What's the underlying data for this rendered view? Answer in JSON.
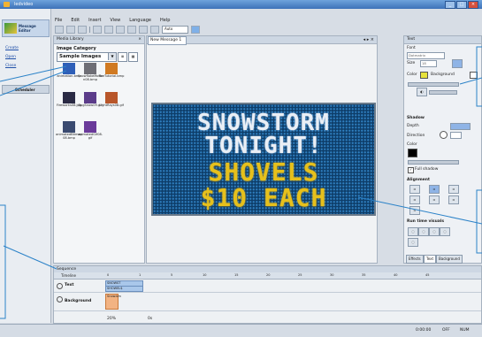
{
  "window": {
    "title": "ledvideo"
  },
  "menu": [
    "File",
    "Edit",
    "Insert",
    "View",
    "Language",
    "Help"
  ],
  "toolbar": {
    "zoom": "Auto"
  },
  "leftnav": {
    "message_editor_label": "Message Editor",
    "links": [
      "Create",
      "Open",
      "Close"
    ],
    "scheduler_label": "Scheduler"
  },
  "media_library": {
    "title": "Media Library",
    "category_label": "Image Category",
    "category_value": "Sample Images",
    "thumbnails": [
      {
        "name": "animation.bmp",
        "color": "#2e5fb8"
      },
      {
        "name": "SnowflakeMotion08.bmp",
        "color": "#6e6e76"
      },
      {
        "name": "FireTutorial.bmp",
        "color": "#d07a22"
      },
      {
        "name": "Fireworks08.jpg",
        "color": "#2a2a44"
      },
      {
        "name": "BugSnow09.gif",
        "color": "#5b3c8a"
      },
      {
        "name": "LightRays08.gif",
        "color": "#b8562a"
      },
      {
        "name": "animatedBitmap08.bmp",
        "color": "#3a4a70"
      },
      {
        "name": "animatedGif08.gif",
        "color": "#6a3a9a"
      }
    ]
  },
  "editor": {
    "tab_label": "New Message 1",
    "sign_lines": [
      "SNOWSTORM",
      "TONIGHT!",
      "SHOVELS",
      "$10 EACH"
    ],
    "text_color": "#e9eef5",
    "accent_color": "#e6c01c"
  },
  "text_panel": {
    "title": "Text",
    "font_label": "Font",
    "font_value": "Dotmatrix",
    "size_label": "Size",
    "size_value": "18",
    "color_label": "Color",
    "background_label": "Background",
    "shadow_label": "Shadow",
    "depth_label": "Depth",
    "direction_label": "Direction",
    "shadow_color_label": "Color",
    "full_shadow_label": "Full shadow",
    "alignment_label": "Alignment",
    "run_time_label": "Run time visuals",
    "tabs": [
      "Effects",
      "Text",
      "Background"
    ]
  },
  "timeline": {
    "title": "Sequence",
    "timeline_label": "Timeline",
    "row_text": "Text",
    "row_bg": "Background",
    "bar1": "SNOWST",
    "bar2": "SHOWEL$",
    "bar3": "Snow.bm",
    "zoom": "20%",
    "value": "0s",
    "ruler": [
      "0",
      "1",
      "5",
      "10",
      "15",
      "20",
      "25",
      "30",
      "35",
      "40",
      "45"
    ]
  },
  "status": {
    "time": "0:00:00",
    "caps": "OFF",
    "num": "NUM"
  }
}
